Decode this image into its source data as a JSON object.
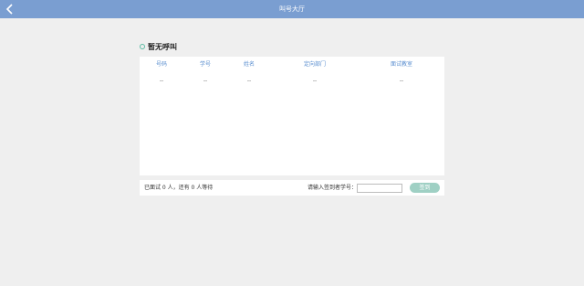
{
  "header": {
    "title": "叫号大厅",
    "back_icon": "chevron-left-icon"
  },
  "status": {
    "icon": "ring-icon",
    "text": "暂无呼叫"
  },
  "table": {
    "columns": [
      "号码",
      "学号",
      "姓名",
      "定向部门",
      "面试教室"
    ],
    "rows": [
      [
        "--",
        "--",
        "--",
        "--",
        "--"
      ]
    ]
  },
  "footer": {
    "summary": "已面试 0 人，还有 0 人等待",
    "prompt": "请输入签到者学号：",
    "input_value": "",
    "input_placeholder": "",
    "sign_label": "签到"
  },
  "colors": {
    "header_bg": "#7a9ed1",
    "column_header": "#5b8fd0",
    "ring": "#5bbba3",
    "button_bg": "#9fd0c4"
  }
}
